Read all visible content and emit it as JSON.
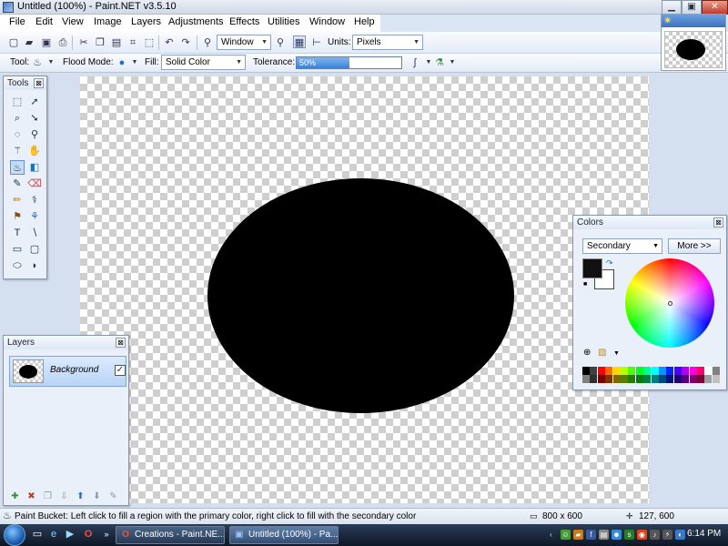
{
  "window": {
    "title": "Untitled (100%) - Paint.NET v3.5.10",
    "minimize": "▁",
    "maximize": "▣",
    "close": "✕"
  },
  "menu": [
    "File",
    "Edit",
    "View",
    "Image",
    "Layers",
    "Adjustments",
    "Effects",
    "Utilities",
    "Window",
    "Help"
  ],
  "toolbar": {
    "zoom_value": "Window",
    "units_label": "Units:",
    "units_value": "Pixels",
    "tool_label": "Tool:",
    "flood_mode_label": "Flood Mode:",
    "fill_label": "Fill:",
    "fill_value": "Solid Color",
    "tolerance_label": "Tolerance:",
    "tolerance_text": "50%",
    "tolerance_value": 0.5
  },
  "tools_panel": {
    "title": "Tools",
    "close": "⊠"
  },
  "layers_panel": {
    "title": "Layers",
    "close": "⊠",
    "layer_name": "Background",
    "layer_visible": "✓"
  },
  "colors_panel": {
    "title": "Colors",
    "close": "⊠",
    "target": "Secondary",
    "more_button": "More >>",
    "primary_color": "#111111",
    "secondary_color": "#ffffff"
  },
  "status": {
    "message": "Paint Bucket: Left click to fill a region with the primary color, right click to fill with the secondary color",
    "image_size": "800 x 600",
    "cursor_position": "127, 600"
  },
  "taskbar": {
    "tasks": [
      {
        "label": "Creations - Paint.NE...",
        "icon": "opera-icon"
      },
      {
        "label": "Untitled (100%) - Pa...",
        "icon": "paintnet-icon"
      }
    ],
    "clock": "6:14 PM"
  }
}
